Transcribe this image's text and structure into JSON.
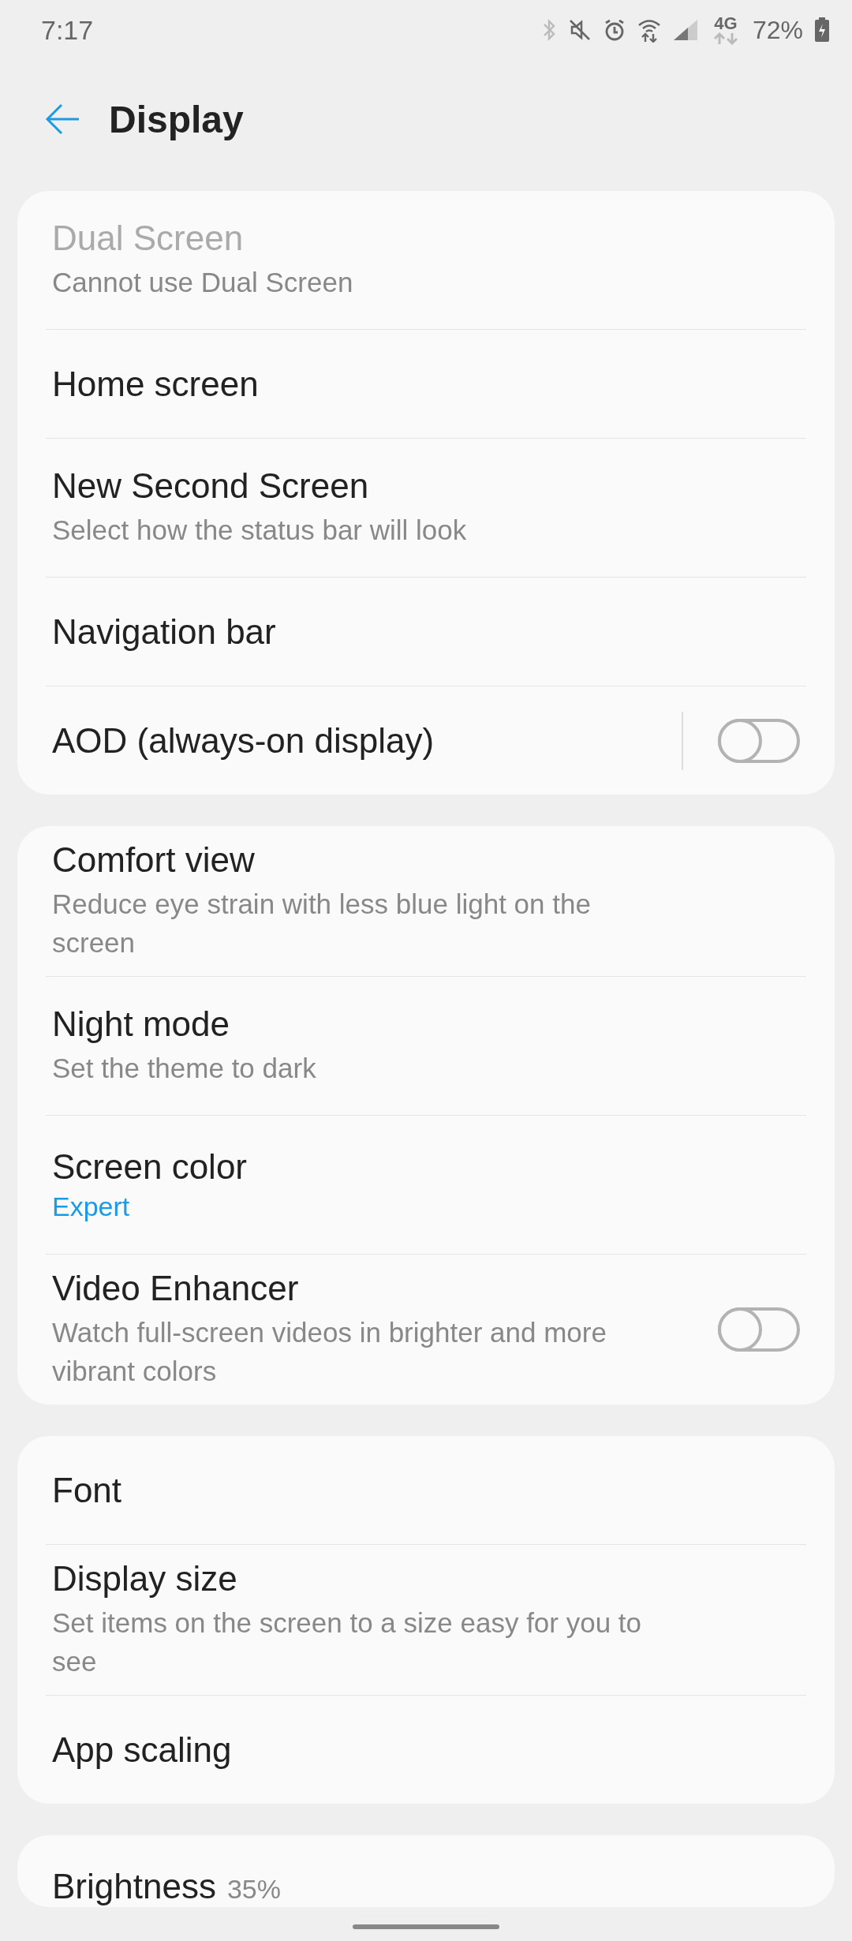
{
  "status_bar": {
    "time": "7:17",
    "network": "4G",
    "battery": "72%"
  },
  "header": {
    "title": "Display"
  },
  "groups": [
    {
      "items": [
        {
          "title": "Dual Screen",
          "summary": "Cannot use Dual Screen",
          "disabled": true
        },
        {
          "title": "Home screen",
          "disabled": false
        },
        {
          "title": "New Second Screen",
          "summary": "Select how the status bar will look",
          "disabled": false
        },
        {
          "title": "Navigation bar",
          "disabled": false
        },
        {
          "title": "AOD (always-on display)",
          "disabled": false,
          "toggle": {
            "on": false,
            "divider": true
          }
        }
      ]
    },
    {
      "items": [
        {
          "title": "Comfort view",
          "summary": "Reduce eye strain with less blue light on the screen",
          "disabled": false
        },
        {
          "title": "Night mode",
          "summary": "Set the theme to dark",
          "disabled": false
        },
        {
          "title": "Screen color",
          "value": "Expert",
          "disabled": false
        },
        {
          "title": "Video Enhancer",
          "summary": "Watch full-screen videos in brighter and more vibrant colors",
          "disabled": false,
          "toggle": {
            "on": false,
            "divider": false
          }
        }
      ]
    },
    {
      "items": [
        {
          "title": "Font",
          "disabled": false
        },
        {
          "title": "Display size",
          "summary": "Set items on the screen to a size easy for you to see",
          "disabled": false
        },
        {
          "title": "App scaling",
          "disabled": false
        }
      ]
    }
  ],
  "brightness": {
    "title": "Brightness",
    "reading": "35%"
  }
}
